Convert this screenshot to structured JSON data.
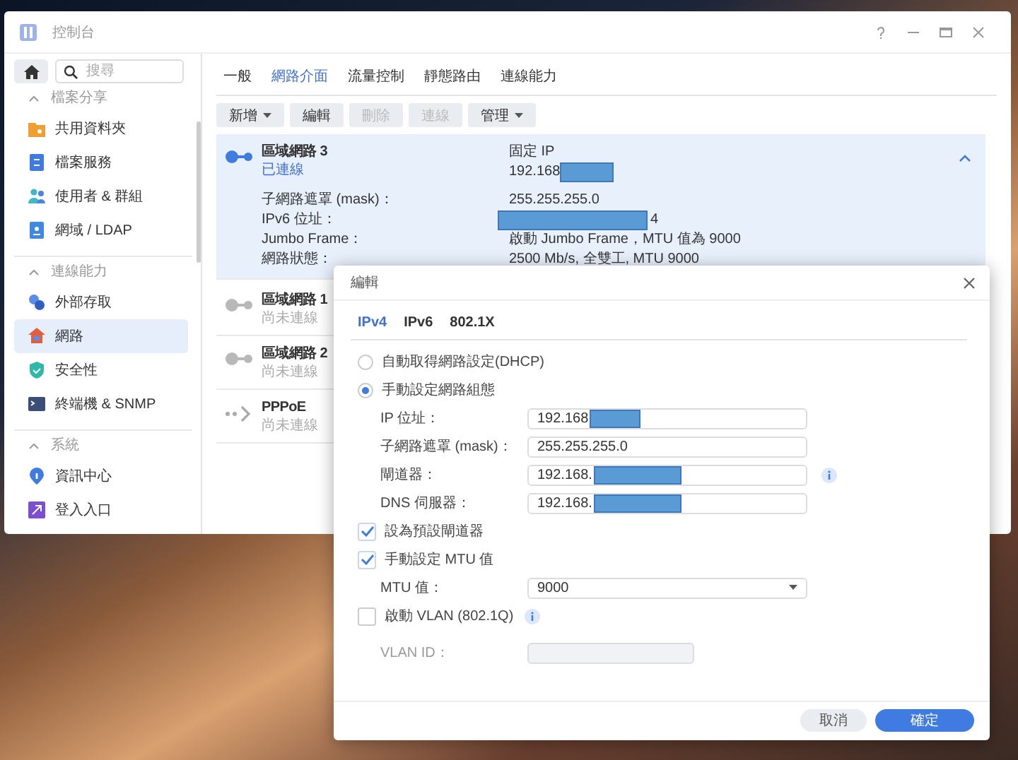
{
  "window": {
    "title": "控制台"
  },
  "sidebar": {
    "search": {
      "placeholder": "搜尋"
    },
    "sections": [
      {
        "title": "檔案分享",
        "expanded": true,
        "items": [
          {
            "label": "共用資料夾",
            "kind": "folder",
            "selected": false
          },
          {
            "label": "檔案服務",
            "kind": "fileservice",
            "selected": false
          },
          {
            "label": "使用者 & 群組",
            "kind": "users",
            "selected": false
          },
          {
            "label": "網域 / LDAP",
            "kind": "domain",
            "selected": false
          }
        ]
      },
      {
        "title": "連線能力",
        "expanded": true,
        "items": [
          {
            "label": "外部存取",
            "kind": "external",
            "selected": false
          },
          {
            "label": "網路",
            "kind": "network",
            "selected": true
          },
          {
            "label": "安全性",
            "kind": "security",
            "selected": false
          },
          {
            "label": "終端機 & SNMP",
            "kind": "terminal",
            "selected": false
          }
        ]
      },
      {
        "title": "系統",
        "expanded": true,
        "items": [
          {
            "label": "資訊中心",
            "kind": "info",
            "selected": false
          },
          {
            "label": "登入入口",
            "kind": "portal",
            "selected": false
          }
        ]
      }
    ]
  },
  "tabs": [
    {
      "label": "一般",
      "selected": false
    },
    {
      "label": "網路介面",
      "selected": true
    },
    {
      "label": "流量控制",
      "selected": false
    },
    {
      "label": "靜態路由",
      "selected": false
    },
    {
      "label": "連線能力",
      "selected": false
    }
  ],
  "toolbar": [
    {
      "label": "新增",
      "dropdown": true,
      "disabled": false
    },
    {
      "label": "編輯",
      "dropdown": false,
      "disabled": false
    },
    {
      "label": "刪除",
      "dropdown": false,
      "disabled": true
    },
    {
      "label": "連線",
      "dropdown": false,
      "disabled": true
    },
    {
      "label": "管理",
      "dropdown": true,
      "disabled": false
    }
  ],
  "interfaces": [
    {
      "name": "區域網路 3",
      "status": "已連線",
      "kind": "lan",
      "connected": true,
      "expanded": true,
      "mode": "固定 IP",
      "address": "192.168",
      "details": [
        {
          "label": "子網路遮罩 (mask)：",
          "value": "255.255.255.0"
        },
        {
          "label": "IPv6 位址：",
          "value": "4",
          "redacted": true
        },
        {
          "label": "Jumbo Frame：",
          "value": "啟動 Jumbo Frame，MTU 值為 9000"
        },
        {
          "label": "網路狀態：",
          "value": "2500 Mb/s, 全雙工, MTU 9000"
        }
      ]
    },
    {
      "name": "區域網路 1",
      "status": "尚未連線",
      "kind": "lan",
      "connected": false,
      "expanded": false
    },
    {
      "name": "區域網路 2",
      "status": "尚未連線",
      "kind": "lan",
      "connected": false,
      "expanded": false
    },
    {
      "name": "PPPoE",
      "status": "尚未連線",
      "kind": "pppoe",
      "connected": false,
      "expanded": false
    }
  ],
  "dialog": {
    "title": "編輯",
    "tabs": [
      {
        "label": "IPv4",
        "selected": true
      },
      {
        "label": "IPv6",
        "selected": false
      },
      {
        "label": "802.1X",
        "selected": false
      }
    ],
    "rows": [
      {
        "kind": "radio",
        "label": "自動取得網路設定(DHCP)",
        "selected": false
      },
      {
        "kind": "radio",
        "label": "手動設定網路組態",
        "selected": true
      },
      {
        "kind": "field",
        "label": "IP 位址：",
        "value": "192.168",
        "redacted": true,
        "disabled": false
      },
      {
        "kind": "field",
        "label": "子網路遮罩 (mask)：",
        "value": "255.255.255.0",
        "disabled": false
      },
      {
        "kind": "field",
        "label": "閘道器：",
        "value": "192.168.",
        "redacted": true,
        "info": true,
        "disabled": false
      },
      {
        "kind": "field",
        "label": "DNS 伺服器：",
        "value": "192.168.",
        "redacted": true,
        "disabled": false
      },
      {
        "kind": "checkbox",
        "label": "設為預設閘道器",
        "checked": true
      },
      {
        "kind": "checkbox",
        "label": "手動設定 MTU 值",
        "checked": true
      },
      {
        "kind": "select",
        "label": "MTU 值：",
        "value": "9000"
      },
      {
        "kind": "checkbox",
        "label": "啟動 VLAN (802.1Q)",
        "checked": false,
        "info": true
      },
      {
        "kind": "field",
        "label": "VLAN ID：",
        "disabled": true
      }
    ],
    "buttons": [
      {
        "label": "取消",
        "kind": "secondary"
      },
      {
        "label": "確定",
        "kind": "primary"
      }
    ]
  }
}
